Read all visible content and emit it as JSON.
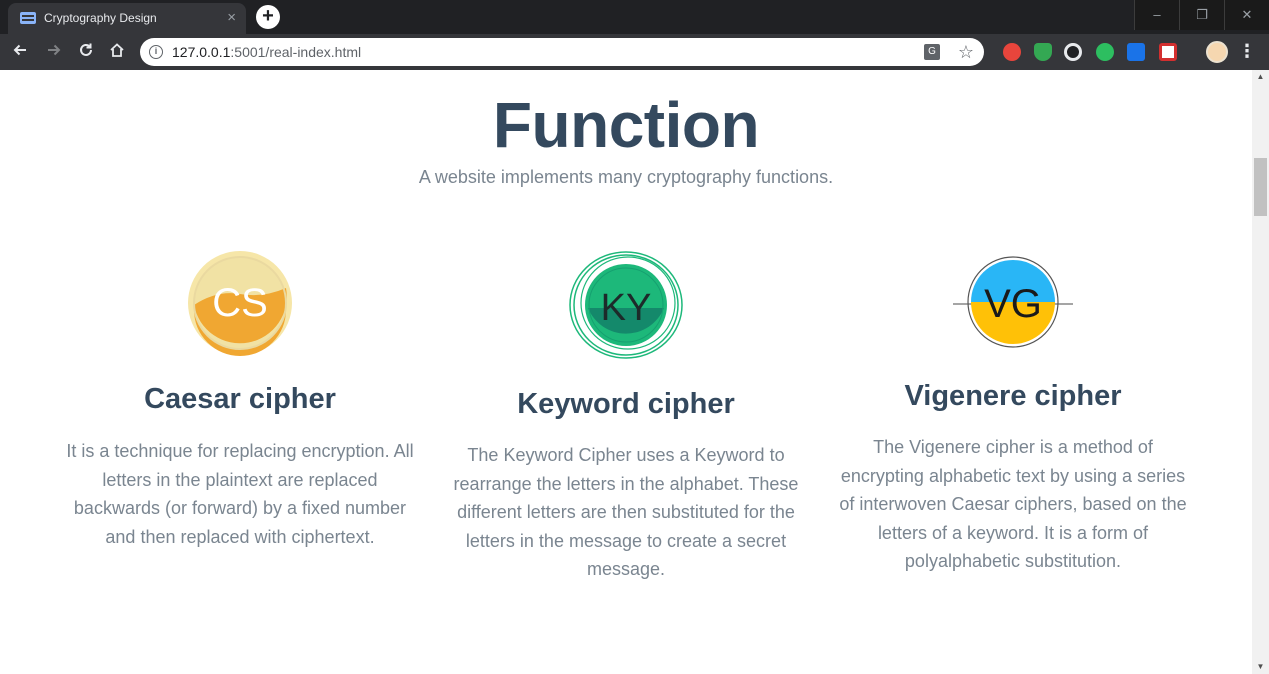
{
  "browser": {
    "tab_title": "Cryptography Design",
    "tab_close": "×",
    "new_tab": "+",
    "url_host": "127.0.0.1",
    "url_path": ":5001/real-index.html",
    "window_controls": [
      "–",
      "❐",
      "✕"
    ]
  },
  "page": {
    "title": "Function",
    "subtitle": "A website implements many cryptography functions."
  },
  "features": [
    {
      "logo_text": "CS",
      "title": "Caesar cipher",
      "description": "It is a technique for replacing encryption. All letters in the plaintext are replaced backwards (or forward) by a fixed number and then replaced with ciphertext."
    },
    {
      "logo_text": "KY",
      "title": "Keyword cipher",
      "description": "The Keyword Cipher uses a Keyword to rearrange the letters in the alphabet. These different letters are then substituted for the letters in the message to create a secret message."
    },
    {
      "logo_text": "VG",
      "title": "Vigenere cipher",
      "description": "The Vigenere cipher is a method of encrypting alphabetic text by using a series of interwoven Caesar ciphers, based on the letters of a keyword. It is a form of polyalphabetic substitution."
    }
  ],
  "colors": {
    "heading": "#34495e",
    "body_text": "#7a8590",
    "caesar_logo": "#f0a732",
    "keyword_logo": "#1db87a",
    "vigenere_top": "#29b6f6",
    "vigenere_bottom": "#ffc107"
  },
  "icons": [
    "back-arrow-icon",
    "forward-arrow-icon",
    "reload-icon",
    "home-icon",
    "info-icon",
    "translate-icon",
    "star-icon",
    "menu-icon"
  ]
}
